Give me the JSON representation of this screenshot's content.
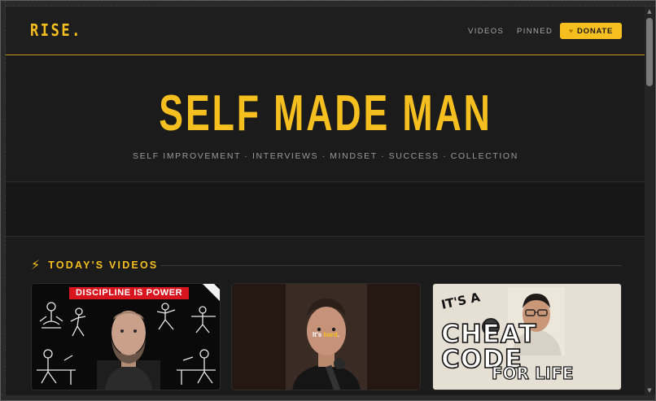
{
  "brand": {
    "logo": "RISE.",
    "accent": "#f5bf1f"
  },
  "nav": {
    "videos": "VIDEOS",
    "pinned": "PINNED",
    "donate": "DONATE",
    "donate_icon": "heart-icon"
  },
  "hero": {
    "title": "SELF MADE MAN",
    "subtitle": "SELF IMPROVEMENT · INTERVIEWS · MINDSET · SUCCESS · COLLECTION"
  },
  "videos_section": {
    "icon": "lightning-bolt-icon",
    "title": "TODAY'S VIDEOS",
    "cards": [
      {
        "banner": "DISCIPLINE IS POWER"
      },
      {
        "caption": "It's hard.",
        "caption_highlight": "hard"
      },
      {
        "line1": "IT'S A",
        "line2": "CHEAT CODE",
        "line3": "FOR LIFE"
      }
    ]
  }
}
